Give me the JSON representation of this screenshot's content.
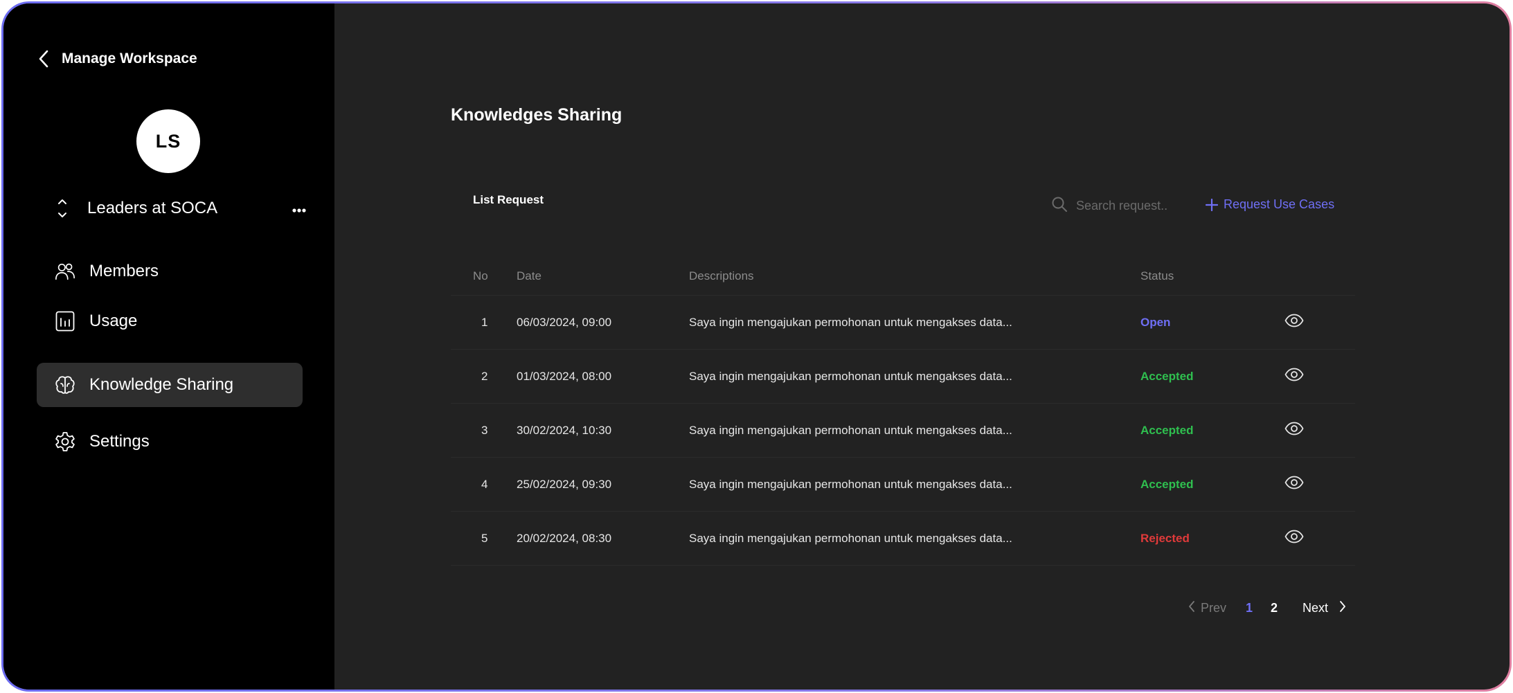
{
  "sidebar": {
    "back_title": "Manage Workspace",
    "avatar_initials": "LS",
    "workspace_name": "Leaders at SOCA",
    "more_label": "•••",
    "nav": [
      {
        "label": "Members",
        "icon": "members-icon"
      },
      {
        "label": "Usage",
        "icon": "usage-icon"
      },
      {
        "label": "Knowledge Sharing",
        "icon": "brain-icon",
        "active": true
      },
      {
        "label": "Settings",
        "icon": "gear-icon"
      }
    ]
  },
  "main": {
    "page_title": "Knowledges Sharing",
    "list_title": "List Request",
    "search_placeholder": "Search request..",
    "request_button": "Request Use Cases",
    "columns": {
      "no": "No",
      "date": "Date",
      "description": "Descriptions",
      "status": "Status"
    },
    "rows": [
      {
        "no": "1",
        "date": "06/03/2024, 09:00",
        "description": "Saya ingin mengajukan permohonan untuk mengakses data...",
        "status": "Open"
      },
      {
        "no": "2",
        "date": "01/03/2024, 08:00",
        "description": "Saya ingin mengajukan permohonan untuk mengakses data...",
        "status": "Accepted"
      },
      {
        "no": "3",
        "date": "30/02/2024, 10:30",
        "description": "Saya ingin mengajukan permohonan untuk mengakses data...",
        "status": "Accepted"
      },
      {
        "no": "4",
        "date": "25/02/2024, 09:30",
        "description": "Saya ingin mengajukan permohonan untuk mengakses data...",
        "status": "Accepted"
      },
      {
        "no": "5",
        "date": "20/02/2024, 08:30",
        "description": "Saya ingin mengajukan permohonan untuk mengakses data...",
        "status": "Rejected"
      }
    ],
    "pagination": {
      "prev": "Prev",
      "pages": [
        "1",
        "2"
      ],
      "current": "1",
      "next": "Next"
    }
  },
  "colors": {
    "accent": "#6f6ff5",
    "accepted": "#2fbf4f",
    "rejected": "#e03a3a",
    "sidebar_bg": "#000000",
    "main_bg": "#222222"
  }
}
